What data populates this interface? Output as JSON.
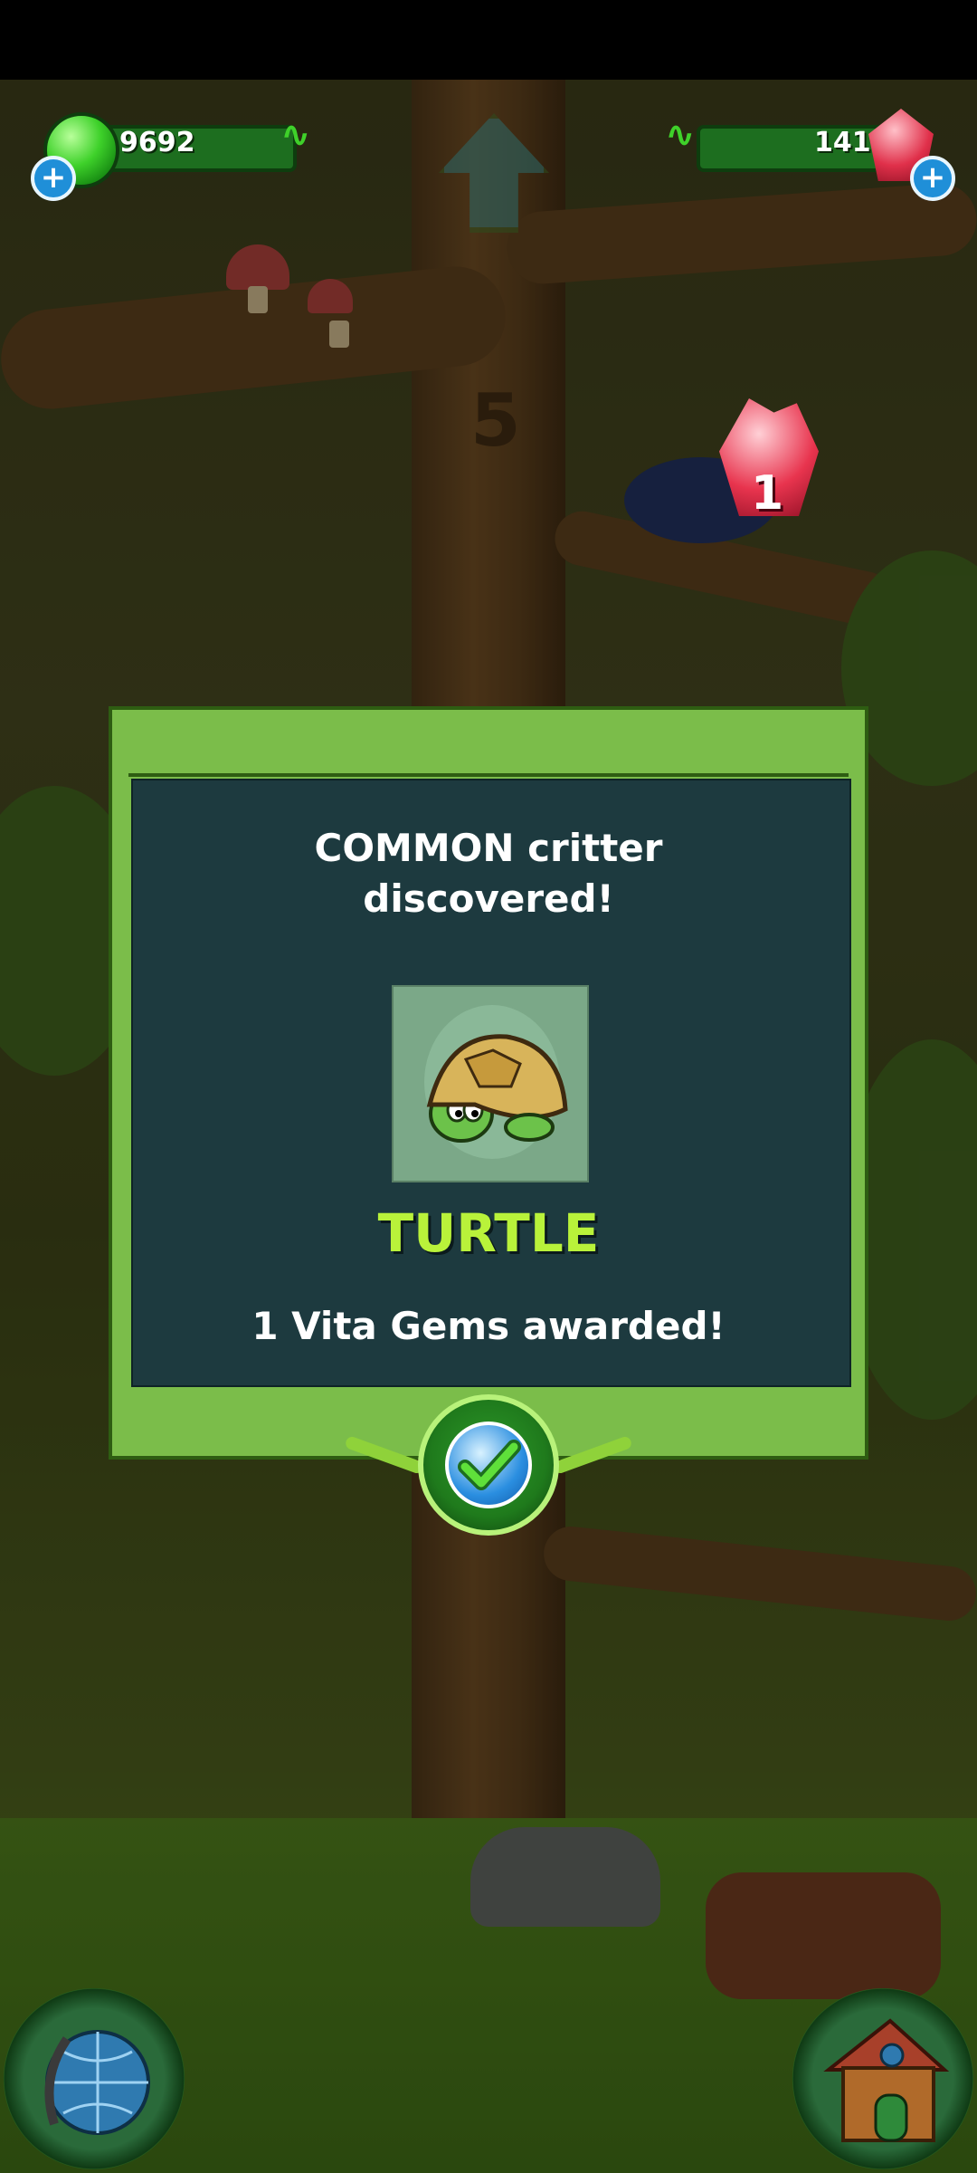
{
  "hud": {
    "green_gems": "9692",
    "red_gems": "141",
    "add_green_label": "+",
    "add_red_label": "+"
  },
  "tree": {
    "level_marker": "5"
  },
  "award_popup_value": "1",
  "dialog": {
    "heading_line1": "COMMON critter",
    "heading_line2": "discovered!",
    "critter_name": "TURTLE",
    "reward_text": "1 Vita Gems awarded!"
  },
  "colors": {
    "critter_name": "#b9f23a",
    "dialog_frame": "#7bbd4a",
    "panel_bg": "#1d3a3f"
  },
  "icons": {
    "left_corner": "globe-icon",
    "right_corner": "house-icon",
    "confirm": "checkmark-icon"
  }
}
